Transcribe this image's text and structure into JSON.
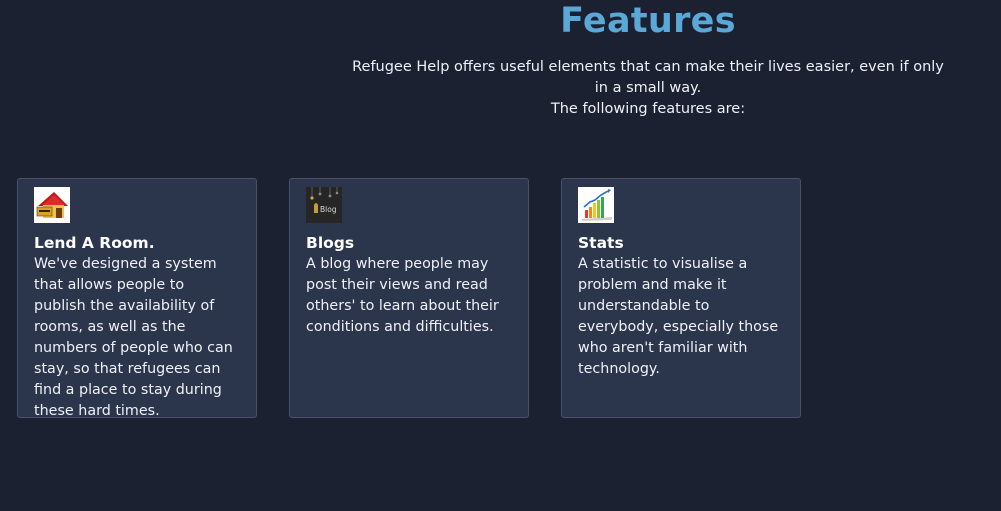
{
  "header": {
    "title": "Features",
    "intro_line1": "Refugee Help offers useful elements that can make their lives easier, even if only in a small way.",
    "intro_line2": "The following features are:"
  },
  "cards": [
    {
      "title": "Lend A Room.",
      "description": "We've designed a system that allows people to publish the availability of rooms, as well as the numbers of people who can stay, so that refugees can find a place to stay during these hard times.",
      "icon": "house-for-rent-icon"
    },
    {
      "title": "Blogs",
      "description": "A blog where people may post their views and read others' to learn about their conditions and difficulties.",
      "icon": "blog-icon",
      "icon_text": "Blog"
    },
    {
      "title": "Stats",
      "description": "A statistic to visualise a problem and make it understandable to everybody, especially those who aren't familiar with technology.",
      "icon": "bar-chart-icon"
    }
  ],
  "colors": {
    "background": "#1b2130",
    "card_background": "#2b354b",
    "accent": "#5aa8d8"
  }
}
